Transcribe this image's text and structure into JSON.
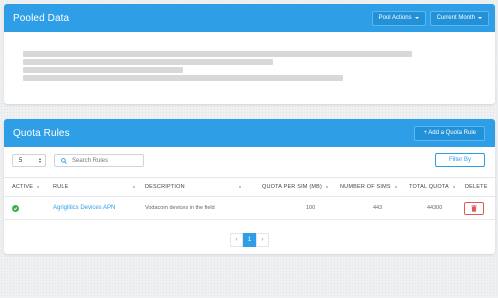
{
  "pooled": {
    "title": "Pooled Data",
    "pool_actions_label": "Pool Actions",
    "current_month_label": "Current Month"
  },
  "quota": {
    "title": "Quota Rules",
    "add_label": "+ Add a Quota Rule",
    "page_size": "5",
    "search_placeholder": "Search Rules",
    "filter_label": "Filter By",
    "columns": {
      "active": "ACTIVE",
      "rule": "RULE",
      "description": "DESCRIPTION",
      "quota_per_sim": "QUOTA PER SIM (MB)",
      "number_of_sims": "NUMBER OF SIMS",
      "total_quota": "TOTAL QUOTA",
      "delete": "DELETE"
    },
    "rows": [
      {
        "rule": "Agriglitics Devices APN",
        "description": "Vodacom devices in the field",
        "quota_per_sim": "100",
        "number_of_sims": "443",
        "total_quota": "44300",
        "active": true
      }
    ],
    "pagination": {
      "prev": "‹",
      "current": "1",
      "next": "›"
    }
  },
  "colors": {
    "header": "#2e9fe6",
    "active": "#34b44a",
    "delete": "#e05a5a"
  },
  "icons": [
    "caret-down-icon",
    "search-icon",
    "check-icon",
    "trash-icon",
    "sort-icon"
  ]
}
